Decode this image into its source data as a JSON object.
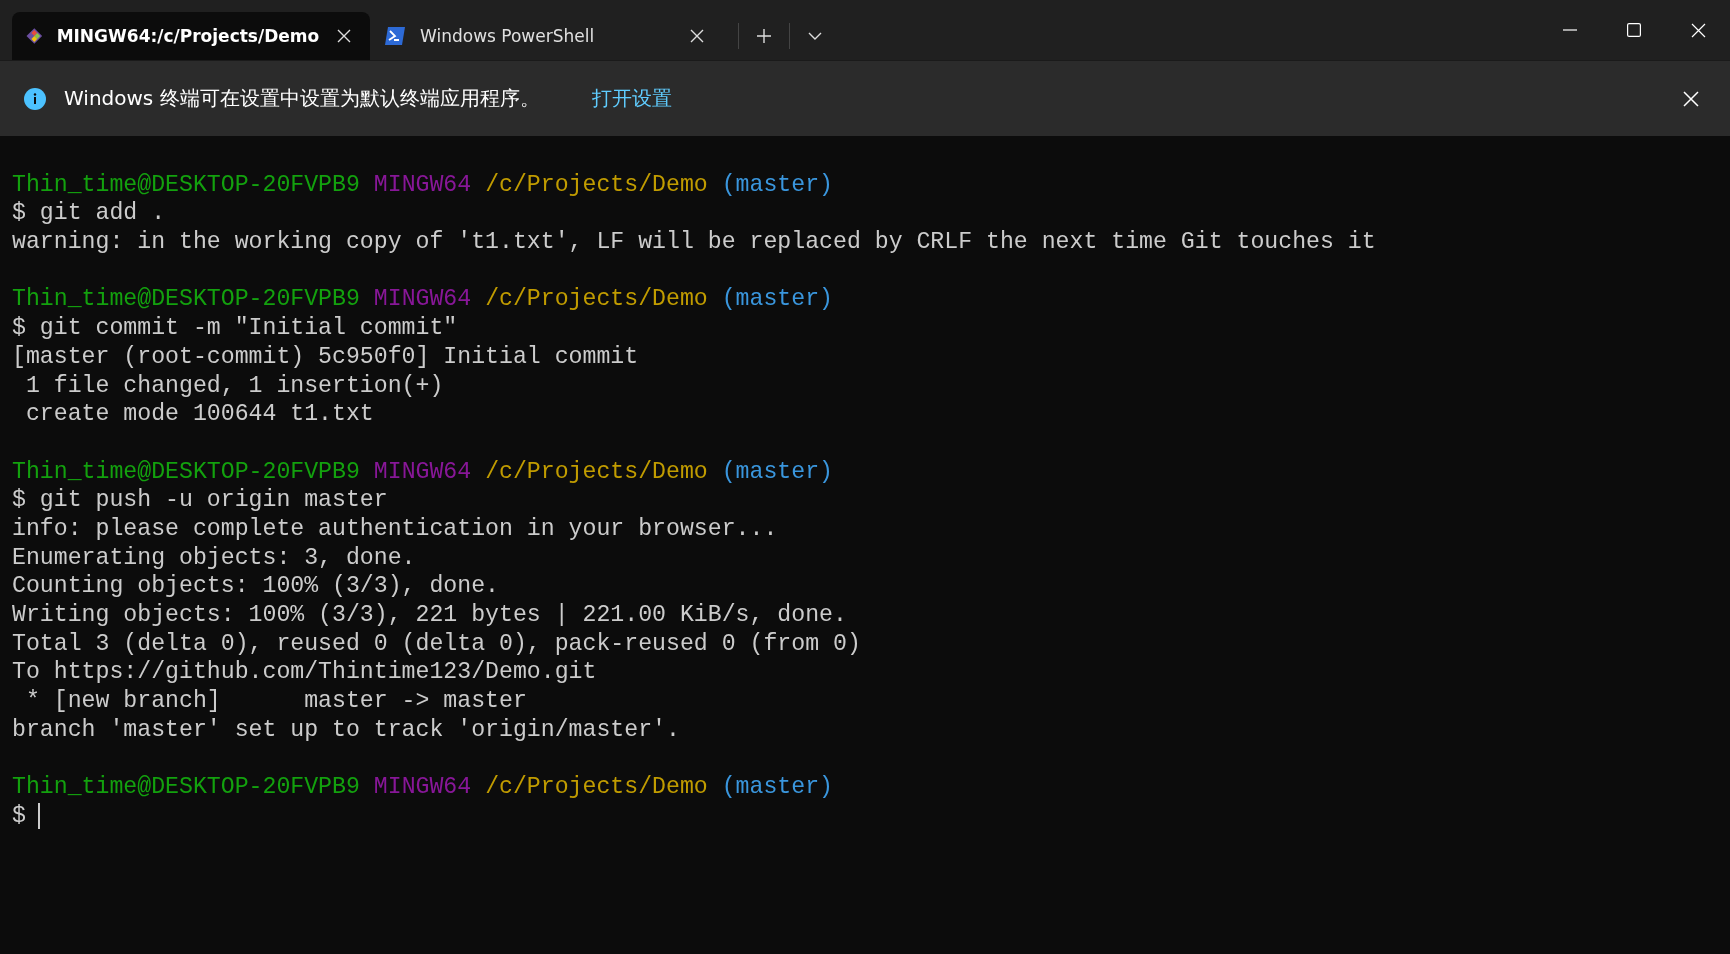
{
  "tabs": [
    {
      "kind": "git",
      "title": "MINGW64:/c/Projects/Demo",
      "selected": true
    },
    {
      "kind": "powershell",
      "title": "Windows PowerShell",
      "selected": false
    }
  ],
  "info_bar": {
    "message": "Windows 终端可在设置中设置为默认终端应用程序。",
    "link": "打开设置"
  },
  "terminal": {
    "lines": [
      {
        "kind": "blank"
      },
      {
        "kind": "prompt",
        "user": "Thin_time@DESKTOP-20FVPB9",
        "system": "MINGW64",
        "path": "/c/Projects/Demo",
        "branch": "(master)"
      },
      {
        "kind": "command",
        "symbol": "$",
        "text": "git add ."
      },
      {
        "kind": "output",
        "text": "warning: in the working copy of 't1.txt', LF will be replaced by CRLF the next time Git touches it"
      },
      {
        "kind": "blank"
      },
      {
        "kind": "prompt",
        "user": "Thin_time@DESKTOP-20FVPB9",
        "system": "MINGW64",
        "path": "/c/Projects/Demo",
        "branch": "(master)"
      },
      {
        "kind": "command",
        "symbol": "$",
        "text": "git commit -m \"Initial commit\""
      },
      {
        "kind": "output",
        "text": "[master (root-commit) 5c950f0] Initial commit"
      },
      {
        "kind": "output",
        "text": " 1 file changed, 1 insertion(+)"
      },
      {
        "kind": "output",
        "text": " create mode 100644 t1.txt"
      },
      {
        "kind": "blank"
      },
      {
        "kind": "prompt",
        "user": "Thin_time@DESKTOP-20FVPB9",
        "system": "MINGW64",
        "path": "/c/Projects/Demo",
        "branch": "(master)"
      },
      {
        "kind": "command",
        "symbol": "$",
        "text": "git push -u origin master"
      },
      {
        "kind": "output",
        "text": "info: please complete authentication in your browser..."
      },
      {
        "kind": "output",
        "text": "Enumerating objects: 3, done."
      },
      {
        "kind": "output",
        "text": "Counting objects: 100% (3/3), done."
      },
      {
        "kind": "output",
        "text": "Writing objects: 100% (3/3), 221 bytes | 221.00 KiB/s, done."
      },
      {
        "kind": "output",
        "text": "Total 3 (delta 0), reused 0 (delta 0), pack-reused 0 (from 0)"
      },
      {
        "kind": "output",
        "text": "To https://github.com/Thintime123/Demo.git"
      },
      {
        "kind": "output",
        "text": " * [new branch]      master -> master"
      },
      {
        "kind": "output",
        "text": "branch 'master' set up to track 'origin/master'."
      },
      {
        "kind": "blank"
      },
      {
        "kind": "prompt",
        "user": "Thin_time@DESKTOP-20FVPB9",
        "system": "MINGW64",
        "path": "/c/Projects/Demo",
        "branch": "(master)"
      },
      {
        "kind": "input",
        "symbol": "$"
      }
    ]
  }
}
